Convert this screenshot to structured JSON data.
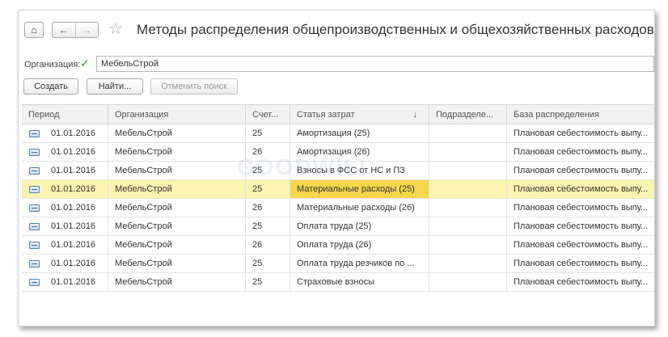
{
  "window": {
    "title": "Методы распределения общепроизводственных и общехозяйственных расходов",
    "home_icon": "⌂",
    "back_icon": "←",
    "forward_icon": "→",
    "star_icon": "☆"
  },
  "filter": {
    "org_label": "Организация:",
    "org_checked": "✓",
    "org_value": "МебельСтрой"
  },
  "toolbar": {
    "create_label": "Создать",
    "find_label": "Найти...",
    "cancel_search_label": "Отменить поиск"
  },
  "table": {
    "columns": [
      "Период",
      "Организация",
      "Счет...",
      "Статья затрат",
      "Подразделе...",
      "База распределения"
    ],
    "sort_indicator": "↓",
    "rows": [
      {
        "period": "01.01.2016",
        "org": "МебельСтрой",
        "account": "25",
        "cost_item": "Амортизация (25)",
        "division": "",
        "base": "Плановая себестоимость выпу..."
      },
      {
        "period": "01.01.2016",
        "org": "МебельСтрой",
        "account": "26",
        "cost_item": "Амортизация (26)",
        "division": "",
        "base": "Плановая себестоимость выпу..."
      },
      {
        "period": "01.01.2016",
        "org": "МебельСтрой",
        "account": "25",
        "cost_item": "Взносы в ФСС от НС и ПЗ",
        "division": "",
        "base": "Плановая себестоимость выпу..."
      },
      {
        "period": "01.01.2016",
        "org": "МебельСтрой",
        "account": "25",
        "cost_item": "Материальные расходы (25)",
        "division": "",
        "base": "Плановая себестоимость выпу..."
      },
      {
        "period": "01.01.2016",
        "org": "МебельСтрой",
        "account": "26",
        "cost_item": "Материальные расходы (26)",
        "division": "",
        "base": "Плановая себестоимость выпу..."
      },
      {
        "period": "01.01.2016",
        "org": "МебельСтрой",
        "account": "25",
        "cost_item": "Оплата труда (25)",
        "division": "",
        "base": "Плановая себестоимость выпу..."
      },
      {
        "period": "01.01.2016",
        "org": "МебельСтрой",
        "account": "26",
        "cost_item": "Оплата труда (26)",
        "division": "",
        "base": "Плановая себестоимость выпу..."
      },
      {
        "period": "01.01.2016",
        "org": "МебельСтрой",
        "account": "25",
        "cost_item": "Оплата труда резчиков по ...",
        "division": "",
        "base": "Плановая себестоимость выпу..."
      },
      {
        "period": "01.01.2016",
        "org": "МебельСтрой",
        "account": "25",
        "cost_item": "Страховые взносы",
        "division": "",
        "base": "Плановая себестоимость выпу..."
      }
    ]
  },
  "watermark_text": "GOODWILL"
}
